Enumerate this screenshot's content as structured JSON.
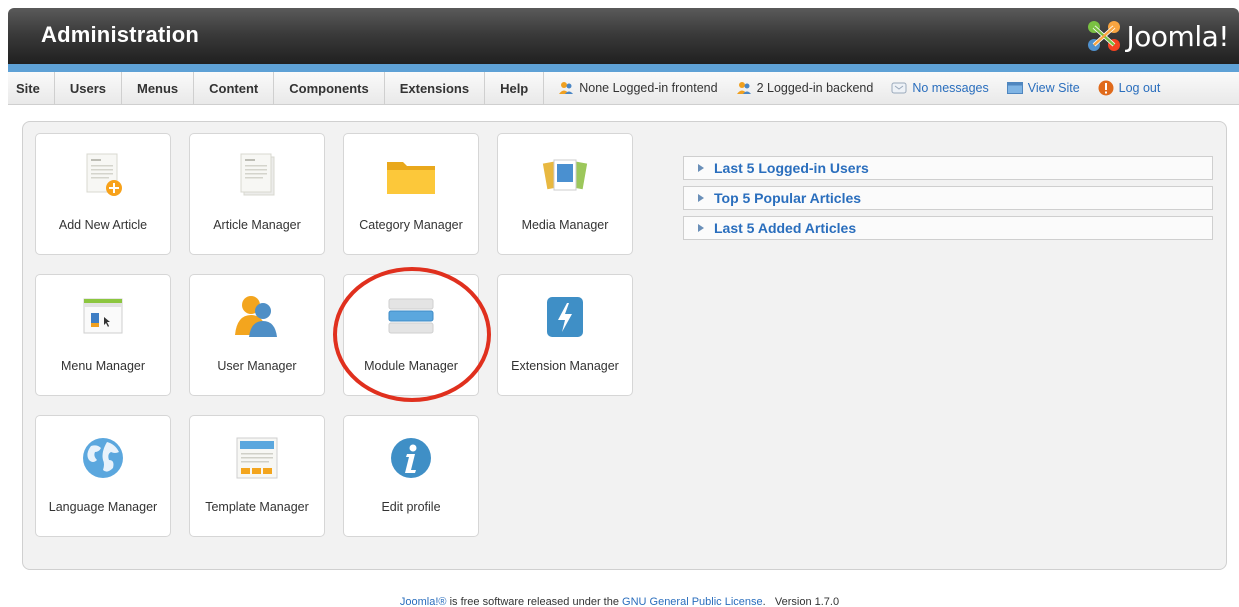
{
  "header": {
    "title": "Administration",
    "logo_text": "Joomla!"
  },
  "menubar": {
    "items": [
      "Site",
      "Users",
      "Menus",
      "Content",
      "Components",
      "Extensions",
      "Help"
    ],
    "status": {
      "frontend": "None Logged-in frontend",
      "backend": "2 Logged-in backend",
      "messages": "No messages",
      "view_site": "View Site",
      "logout": "Log out"
    }
  },
  "tiles": [
    {
      "label": "Add New Article",
      "icon": "add-article-icon"
    },
    {
      "label": "Article Manager",
      "icon": "article-icon"
    },
    {
      "label": "Category Manager",
      "icon": "folder-icon"
    },
    {
      "label": "Media Manager",
      "icon": "media-icon"
    },
    {
      "label": "Menu Manager",
      "icon": "menu-icon"
    },
    {
      "label": "User Manager",
      "icon": "users-icon"
    },
    {
      "label": "Module Manager",
      "icon": "module-icon"
    },
    {
      "label": "Extension Manager",
      "icon": "extension-icon"
    },
    {
      "label": "Language Manager",
      "icon": "globe-icon"
    },
    {
      "label": "Template Manager",
      "icon": "template-icon"
    },
    {
      "label": "Edit profile",
      "icon": "info-icon"
    }
  ],
  "accordion": {
    "items": [
      "Last 5 Logged-in Users",
      "Top 5 Popular Articles",
      "Last 5 Added Articles"
    ]
  },
  "footer": {
    "prefix": "Joomla!®",
    "middle": " is free software released under the ",
    "license": "GNU General Public License",
    "suffix": ".",
    "version": "Version 1.7.0"
  },
  "colors": {
    "link": "#2a6ebd",
    "stripe": "#5ea1d6",
    "annotation": "#e0301e"
  }
}
